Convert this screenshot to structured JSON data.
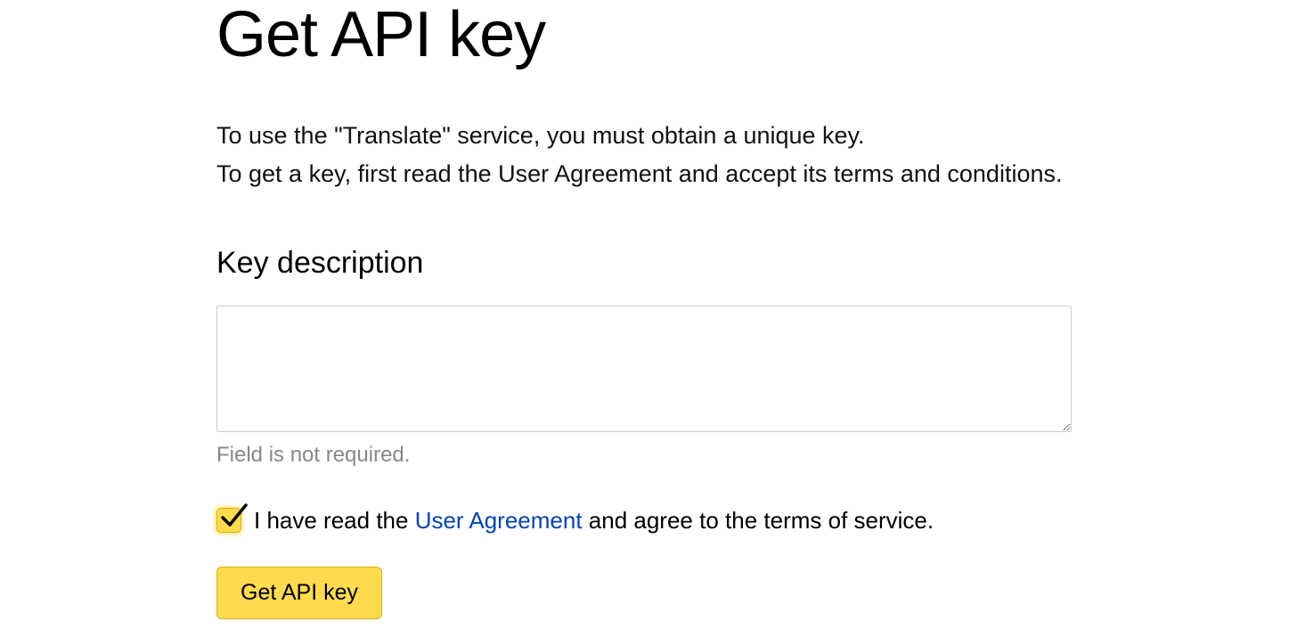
{
  "page": {
    "title": "Get API key",
    "intro_line1": "To use the \"Translate\" service, you must obtain a unique key.",
    "intro_line2": "To get a key, first read the User Agreement and accept its terms and conditions."
  },
  "form": {
    "section_heading": "Key description",
    "description_value": "",
    "field_hint": "Field is not required.",
    "agreement": {
      "checked": true,
      "text_before": "I have read the ",
      "link_text": "User Agreement",
      "text_after": " and agree to the terms of service."
    },
    "submit_label": "Get API key"
  },
  "colors": {
    "accent": "#ffdb4d",
    "link": "#0044bb",
    "hint": "#888888"
  }
}
